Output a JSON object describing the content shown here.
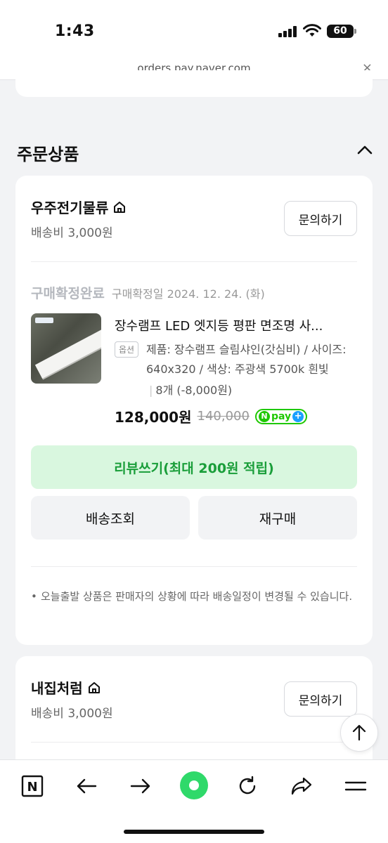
{
  "status_bar": {
    "time": "1:43",
    "battery": "60"
  },
  "browser": {
    "url": "orders.pay.naver.com",
    "close": "×"
  },
  "section": {
    "title": "주문상품"
  },
  "order1": {
    "seller": "우주전기물류",
    "shipping_fee": "배송비 3,000원",
    "ask_label": "문의하기",
    "status": "구매확정완료",
    "confirm_date": "구매확정일 2024. 12. 24. (화)",
    "product_name": "장수램프 LED 엣지등 평판 면조명 사...",
    "option_badge": "옵션",
    "option_text": "제품: 장수램프 슬림샤인(갓심비) / 사이즈: 640x320 / 색상: 주광색 5700k 흰빛",
    "quantity": "8개 (-8,000원)",
    "price": "128,000원",
    "original_price": "140,000",
    "npay_n": "N",
    "npay_text": "pay",
    "npay_plus": "+",
    "review_label": "리뷰쓰기(최대 200원 적립)",
    "track_label": "배송조회",
    "rebuy_label": "재구매",
    "notice": "오늘출발 상품은 판매자의 상황에 따라 배송일정이 변경될 수 있습니다."
  },
  "order2": {
    "seller": "내집처럼",
    "shipping_fee": "배송비 3,000원",
    "ask_label": "문의하기"
  },
  "toolbar": {
    "naver_label": "N"
  }
}
